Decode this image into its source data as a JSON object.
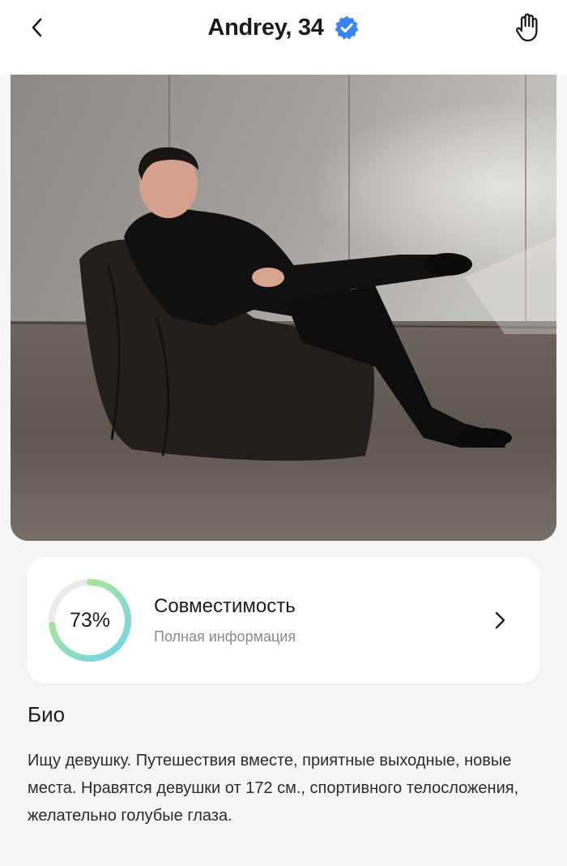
{
  "header": {
    "title": "Andrey, 34",
    "back_icon": "chevron-left-icon",
    "verified_icon": "verified-badge-icon",
    "hand_icon": "hand-stop-icon",
    "verified_color": "#3b82f6"
  },
  "photo": {
    "subject": "profile-photo"
  },
  "compatibility": {
    "percent_label": "73%",
    "percent_value": 73,
    "title": "Совместимость",
    "subtitle": "Полная информация",
    "gradient_start": "#6fd3ef",
    "gradient_end": "#b9ea7d",
    "track_color": "#ebebed"
  },
  "bio": {
    "title": "Био",
    "text": "Ищу девушку. Путешествия вместе, приятные выходные, новые места. Нравятся девушки от 172 см., спортивного телосложения, желательно голубые глаза."
  }
}
